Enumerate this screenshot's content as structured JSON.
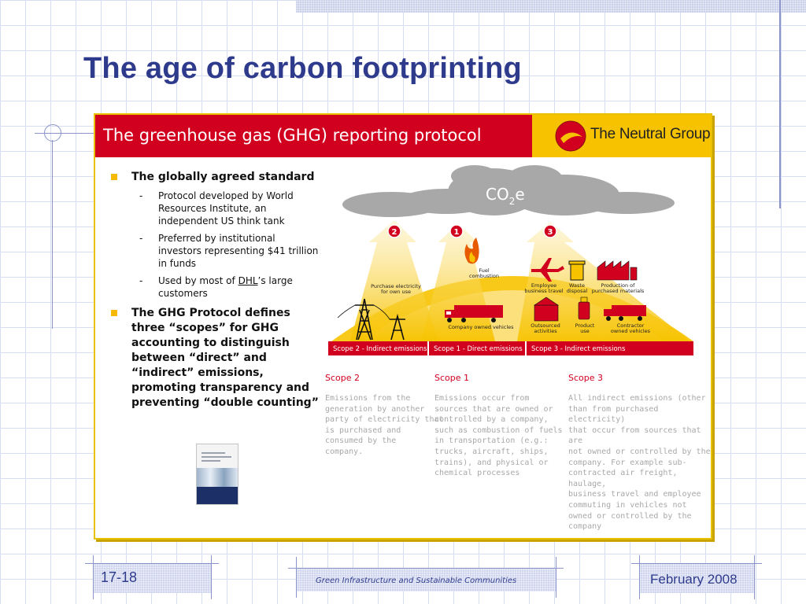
{
  "slide": {
    "title": "The age of carbon footprinting"
  },
  "panel": {
    "banner_title": "The greenhouse gas (GHG) reporting protocol",
    "logo_text": "The Neutral Group"
  },
  "bullets": [
    {
      "text": "The globally agreed standard",
      "subs": [
        {
          "text": "Protocol developed by World Resources Institute, an independent US think tank"
        },
        {
          "text": "Preferred by  institutional investors representing $41 trillion in funds"
        },
        {
          "pre": "Used by most of ",
          "underline": "DHL",
          "post": "’s large customers"
        }
      ]
    },
    {
      "text": "The GHG Protocol defines three “scopes” for GHG accounting to distinguish between “direct”  and “indirect” emissions, promoting transparency and preventing “double counting”",
      "subs": []
    }
  ],
  "diagram": {
    "cloud_label_main": "CO",
    "cloud_label_sub": "2",
    "cloud_label_tail": "e",
    "badges": [
      "2",
      "1",
      "3"
    ],
    "labels": {
      "purchase_electricity": [
        "Purchase electricity",
        "for own use"
      ],
      "fuel_combustion": [
        "Fuel",
        "combustion"
      ],
      "company_vehicles": "Company owned vehicles",
      "employee_travel": [
        "Employee",
        "business travel"
      ],
      "waste_disposal": [
        "Waste",
        "disposal"
      ],
      "production_materials": [
        "Production of",
        "purchased materials"
      ],
      "outsourced": [
        "Outsourced",
        "activities"
      ],
      "product_use": [
        "Product",
        "use"
      ],
      "contractor_vehicles": [
        "Contractor",
        "owned vehicles"
      ]
    },
    "scope_bar": [
      "Scope 2 - Indirect emissions",
      "Scope 1 - Direct emissions",
      "Scope 3 - Indirect emissions"
    ]
  },
  "scopes": [
    {
      "heading": "Scope 2",
      "lines": [
        "Emissions from the",
        "generation by another",
        "party of electricity that",
        "is purchased and",
        "consumed by the",
        "company."
      ]
    },
    {
      "heading": "Scope 1",
      "lines": [
        "Emissions occur from",
        "sources that are owned or",
        "controlled by a company,",
        "such as combustion of fuels",
        "in transportation (e.g.:",
        "trucks, aircraft, ships,",
        "trains), and physical or",
        "chemical processes"
      ]
    },
    {
      "heading": "Scope 3",
      "lines": [
        "All indirect emissions (other",
        "than from purchased electricity)",
        "that occur from sources that are",
        "not owned or controlled by the",
        "company. For example sub-",
        "contracted air freight, haulage,",
        "business travel and employee",
        "commuting in vehicles not",
        "owned or controlled by the",
        "company"
      ]
    }
  ],
  "footer": {
    "number": "17-18",
    "center": "Green Infrastructure and Sustainable Communities",
    "date": "February 2008"
  },
  "colors": {
    "title_blue": "#2e3a8c",
    "banner_red": "#d2001f",
    "logo_yellow": "#f7c300",
    "bullet_yellow": "#f7b800",
    "dome_yellow": "#f7c300",
    "cloud_gray": "#a8a8a8"
  }
}
